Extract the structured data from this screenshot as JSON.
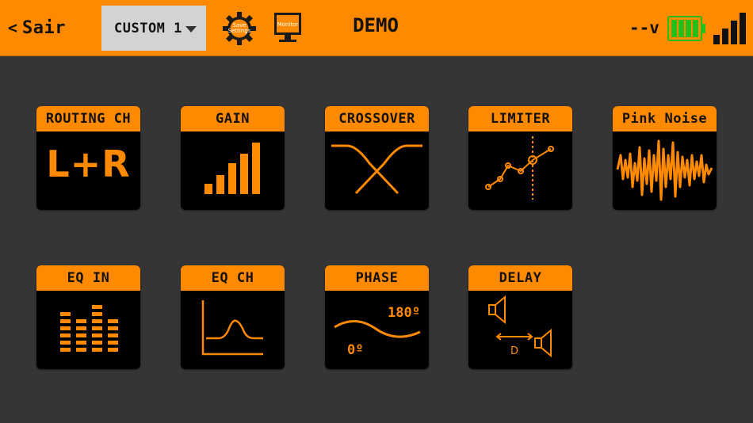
{
  "header": {
    "back_label": "Sair",
    "back_chevron": "<",
    "preset_value": "CUSTOM 1",
    "save_settings_label_line1": "Save",
    "save_settings_label_line2": "Settings",
    "monitor_label": "Monitor",
    "title": "DEMO",
    "voltage": "--v",
    "battery_level": 1.0,
    "signal_bars": 4
  },
  "tiles": [
    {
      "label": "ROUTING CH",
      "icon": "routing-lr-icon",
      "text": "L+R"
    },
    {
      "label": "GAIN",
      "icon": "gain-bars-icon"
    },
    {
      "label": "CROSSOVER",
      "icon": "crossover-icon"
    },
    {
      "label": "LIMITER",
      "icon": "limiter-curve-icon"
    },
    {
      "label": "Pink Noise",
      "icon": "pink-noise-wave-icon"
    },
    {
      "label": "EQ IN",
      "icon": "eq-bars-icon"
    },
    {
      "label": "EQ CH",
      "icon": "eq-peak-curve-icon"
    },
    {
      "label": "PHASE",
      "icon": "phase-wave-icon",
      "upper_value": "180º",
      "lower_value": "0º"
    },
    {
      "label": "DELAY",
      "icon": "delay-speakers-icon",
      "distance_label": "D"
    }
  ],
  "colors": {
    "accent": "#ff8a00",
    "background": "#353535",
    "tile_body": "#000000",
    "battery": "#22c01a"
  }
}
